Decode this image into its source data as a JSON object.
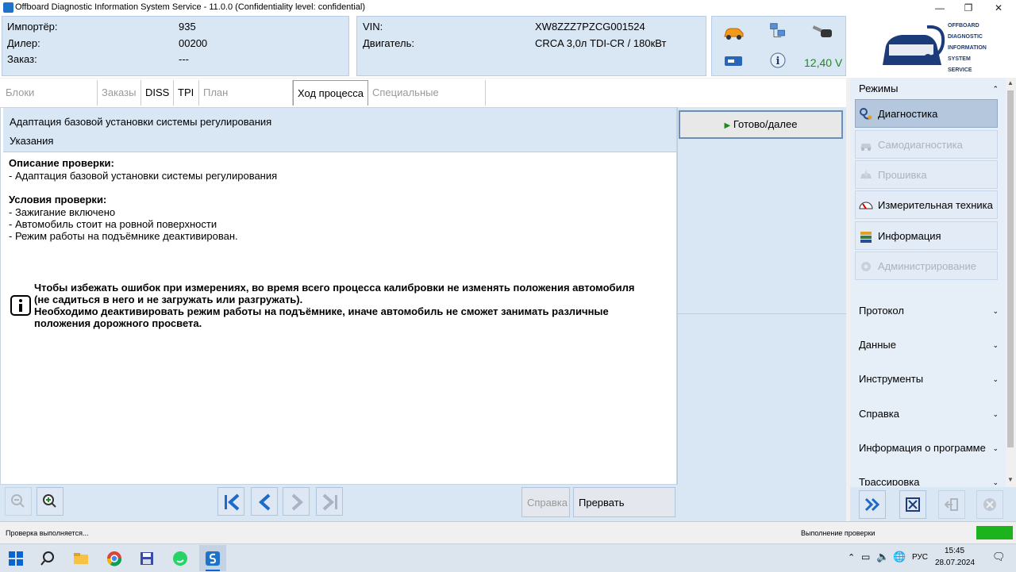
{
  "window": {
    "title": "Offboard Diagnostic Information System Service - 11.0.0 (Confidentiality level: confidential)",
    "minimize": "—",
    "maximize": "❐",
    "close": "✕"
  },
  "header": {
    "importer_label": "Импортёр:",
    "importer_value": "935",
    "dealer_label": "Дилер:",
    "dealer_value": "00200",
    "order_label": "Заказ:",
    "order_value": "---",
    "vin_label": "VIN:",
    "vin_value": "XW8ZZZ7PZCG001524",
    "engine_label": "Двигатель:",
    "engine_value": "CRCA 3,0л TDI-CR / 180кВт",
    "battery_voltage": "12,40 V",
    "logo_lines": [
      "OFFBOARD",
      "DIAGNOSTIC",
      "INFORMATION",
      "SYSTEM",
      "SERVICE"
    ]
  },
  "tabs": [
    {
      "label": "Блоки управления",
      "state": "disabled"
    },
    {
      "label": "Заказы",
      "state": "disabled"
    },
    {
      "label": "DISS",
      "state": "enabled"
    },
    {
      "label": "TPI",
      "state": "enabled"
    },
    {
      "label": "План диагностики",
      "state": "disabled"
    },
    {
      "label": "Ход процесса",
      "state": "selected"
    },
    {
      "label": "Специальные функции",
      "state": "disabled"
    }
  ],
  "step": {
    "title": "Адаптация базовой установки системы регулирования",
    "subtitle": "Указания",
    "description_heading": "Описание проверки:",
    "description_items": [
      "- Адаптация базовой установки системы регулирования"
    ],
    "conditions_heading": "Условия проверки:",
    "conditions_items": [
      "- Зажигание включено",
      "- Автомобиль стоит на ровной поверхности",
      "- Режим работы на подъёмнике деактивирован."
    ],
    "notice_lines": [
      "Чтобы избежать ошибок при измерениях, во время всего процесса калибровки не изменять положения автомобиля",
      "(не садиться в него и не загружать или разгружать).",
      "Необходимо деактивировать режим работы на подъёмнике, иначе автомобиль не сможет занимать различные",
      "положения дорожного просвета."
    ]
  },
  "actions": {
    "next_label": "Готово/далее",
    "help_label": "Справка",
    "abort_label": "Прервать проверку"
  },
  "sidebar": {
    "modes_label": "Режимы",
    "modes": [
      {
        "label": "Диагностика",
        "state": "selected",
        "icon": "stethoscope-icon"
      },
      {
        "label": "Самодиагностика",
        "state": "disabled",
        "icon": "car-diagnostics-icon"
      },
      {
        "label": "Прошивка",
        "state": "disabled",
        "icon": "flash-icon"
      },
      {
        "label": "Измерительная техника",
        "state": "enabled",
        "icon": "gauge-icon"
      },
      {
        "label": "Информация",
        "state": "enabled",
        "icon": "books-icon"
      },
      {
        "label": "Администрирование",
        "state": "disabled",
        "icon": "admin-icon"
      }
    ],
    "sections": [
      "Протокол",
      "Данные",
      "Инструменты",
      "Справка",
      "Информация о программе",
      "Трассировка"
    ]
  },
  "status": {
    "left": "Проверка выполняется...",
    "right": "Выполнение проверки"
  },
  "taskbar": {
    "lang": "РУС",
    "time": "15:45",
    "date": "28.07.2024"
  },
  "colors": {
    "panel_blue": "#d9e6f4",
    "accent_blue": "#1e73c8",
    "battery_green": "#1e8a1e",
    "progress_green": "#1db31d"
  }
}
